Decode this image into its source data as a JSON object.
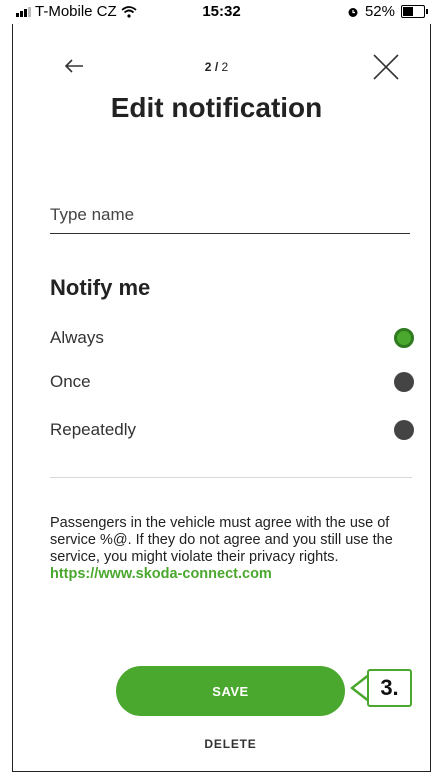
{
  "status_bar": {
    "carrier": "T-Mobile CZ",
    "time": "15:32",
    "battery": "52%",
    "battery_level": 0.52,
    "icons": [
      "signal-icon",
      "wifi-icon",
      "alarm-icon",
      "battery-icon"
    ]
  },
  "header": {
    "step_current": "2",
    "step_separator": " / ",
    "step_total": "2",
    "title": "Edit notification",
    "back_icon": "arrow-left-icon",
    "close_icon": "close-icon"
  },
  "name_input": {
    "value": "",
    "placeholder": "Type name"
  },
  "notify": {
    "title": "Notify me",
    "options": [
      {
        "label": "Always",
        "selected": true
      },
      {
        "label": "Once",
        "selected": false
      },
      {
        "label": "Repeatedly",
        "selected": false
      }
    ]
  },
  "notice": {
    "text": "Passengers in the vehicle must agree with the use of service %@. If they do not agree and you still use the service, you might violate their privacy rights. ",
    "link": "https://www.skoda-connect.com"
  },
  "actions": {
    "save_label": "SAVE",
    "delete_label": "DELETE"
  },
  "annotation": {
    "label": "3."
  },
  "colors": {
    "accent": "#4ba82e",
    "radio_unselected": "#444444"
  }
}
